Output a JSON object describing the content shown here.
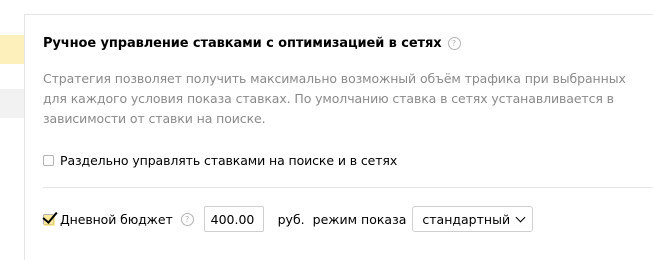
{
  "section": {
    "title": "Ручное управление ставками с оптимизацией в сетях",
    "help_icon": "?",
    "description": "Стратегия позволяет получить максимально возможный объём трафика при выбранных для каждого условия показа ставках. По умолчанию ставка в сетях устанавливается в зависимости от ставки на поиске."
  },
  "separate_bids": {
    "label": "Раздельно управлять ставками на поиске и в сетях",
    "checked": false
  },
  "daily_budget": {
    "label": "Дневной бюджет",
    "help_icon": "?",
    "checked": true,
    "value": "400.00",
    "currency": "руб.",
    "mode_label": "режим показа",
    "mode_value": "стандартный"
  },
  "colors": {
    "accent_yellow": "#fdf0bb",
    "check_yellow": "#ffdb4d",
    "muted_text": "#8a8a8a"
  }
}
